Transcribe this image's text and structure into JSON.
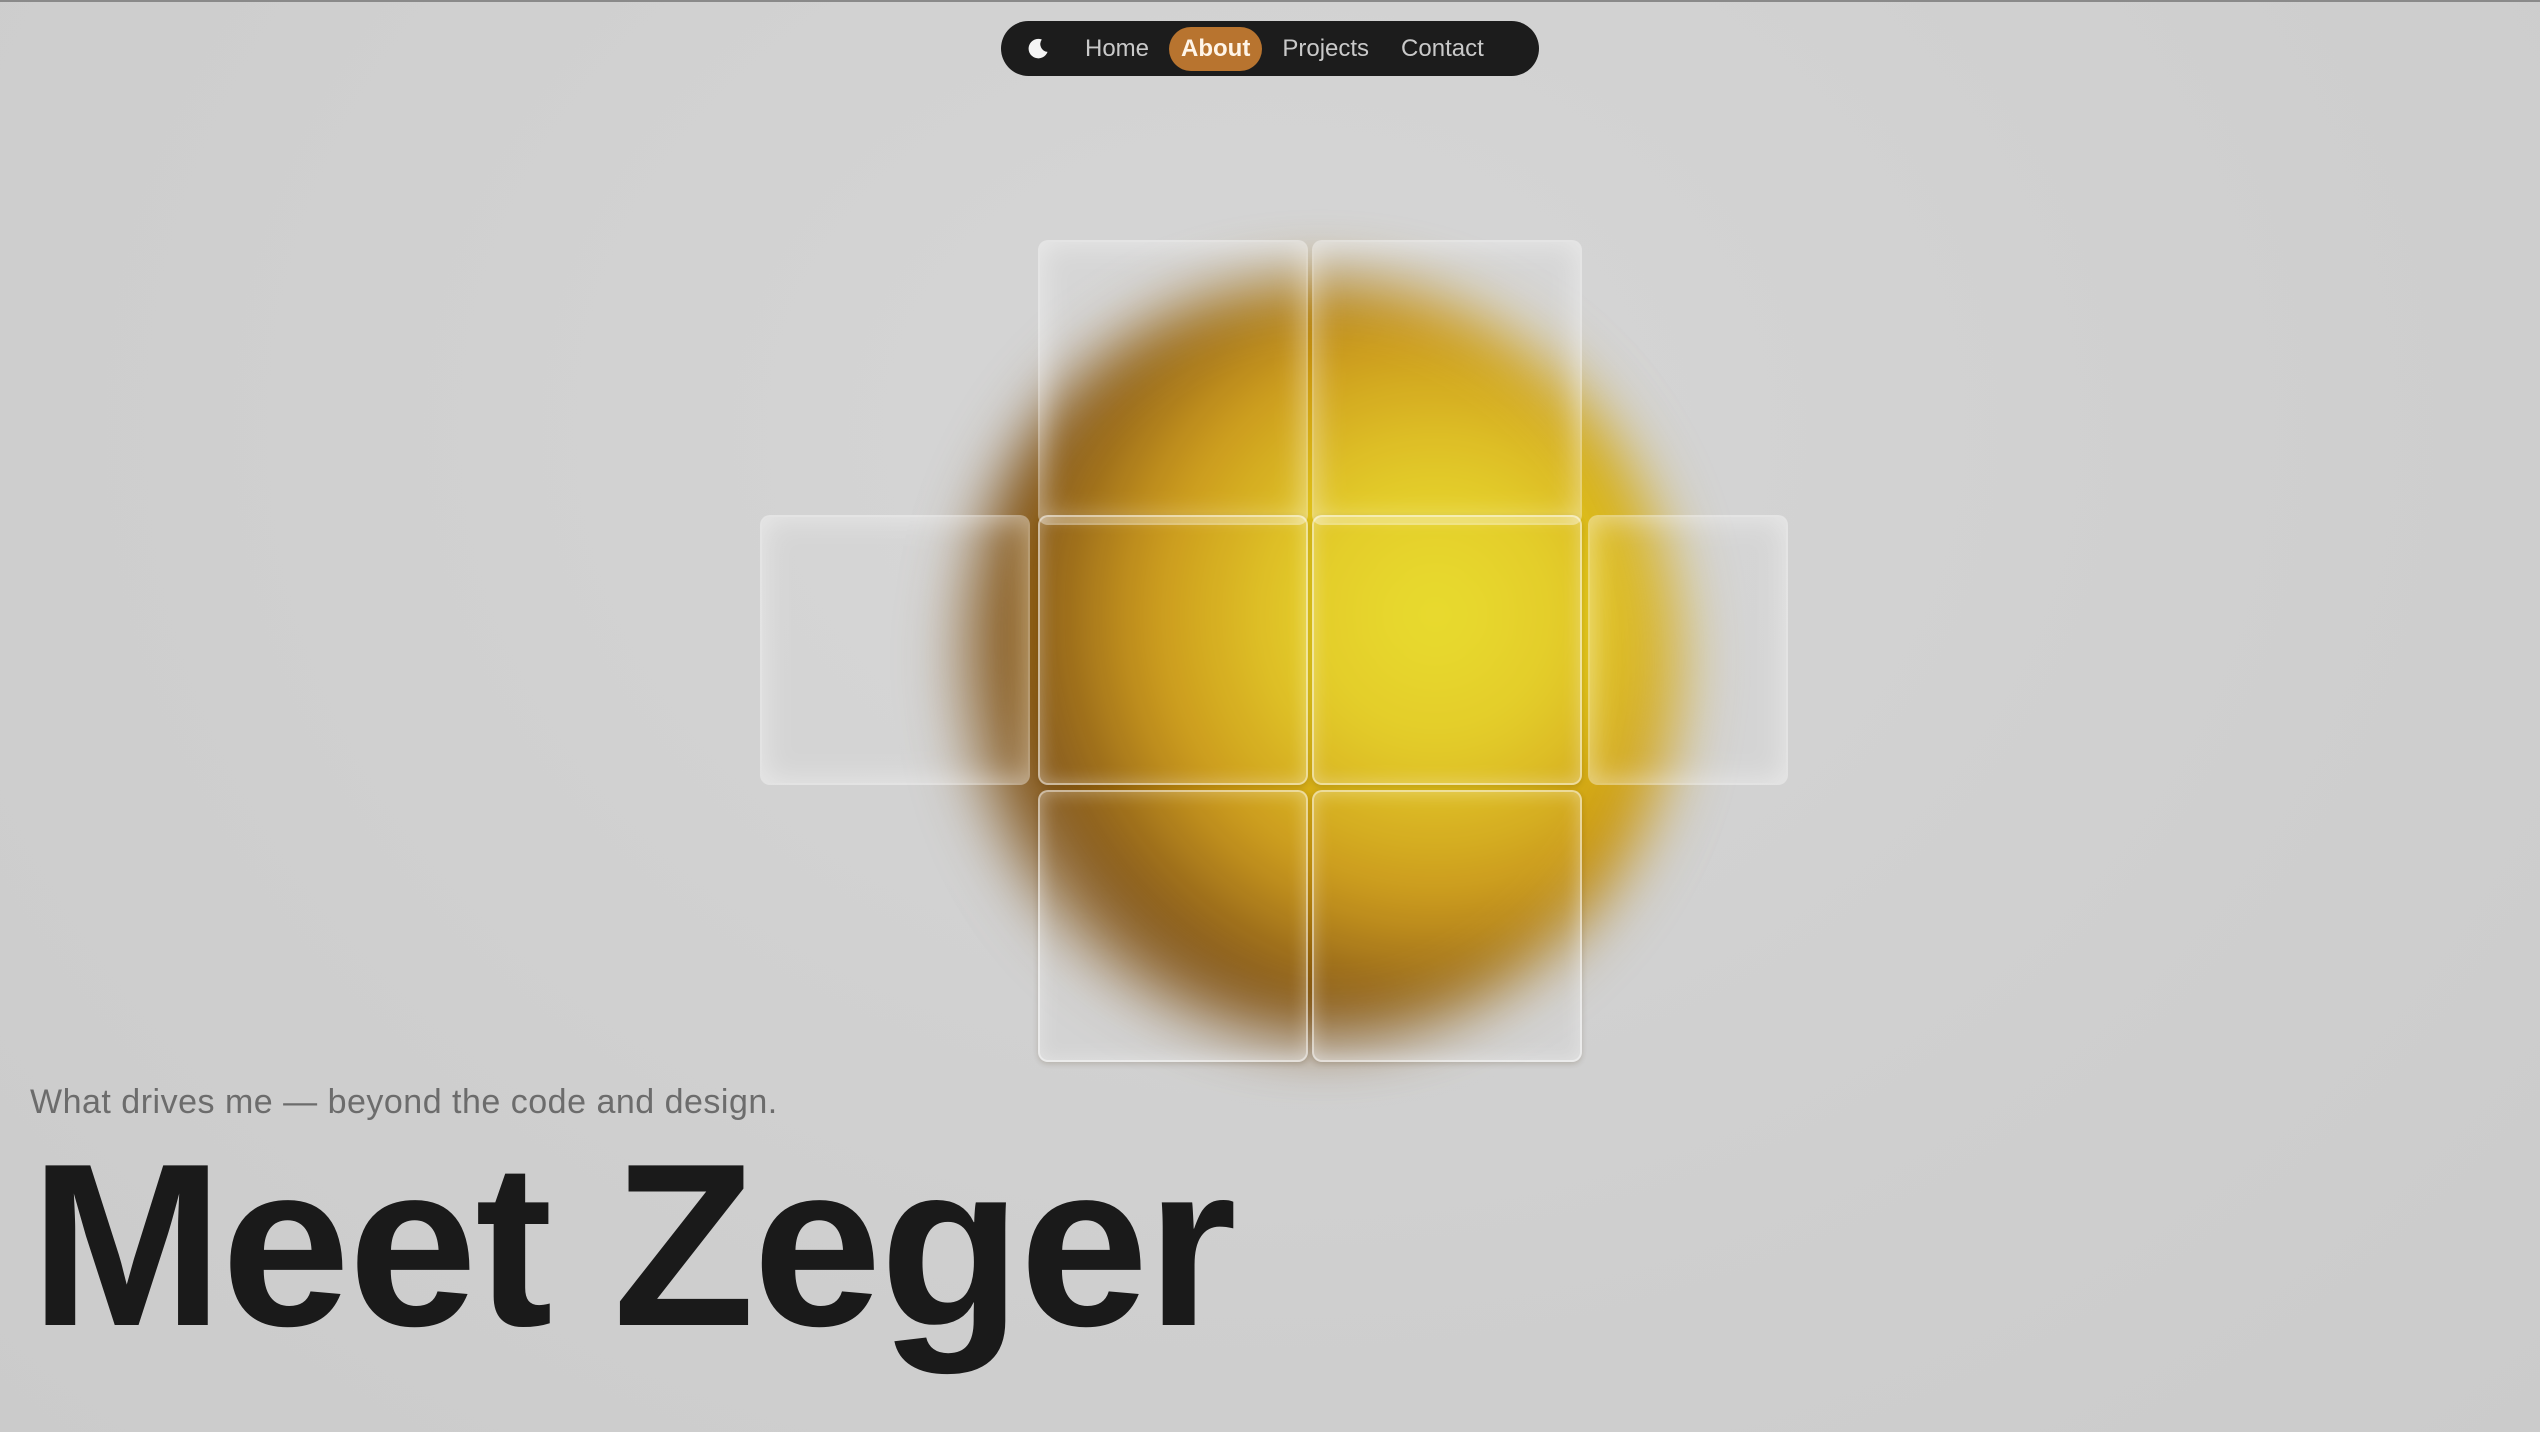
{
  "nav": {
    "theme_toggle_icon": "moon-icon",
    "items": [
      {
        "label": "Home",
        "active": false
      },
      {
        "label": "About",
        "active": true
      },
      {
        "label": "Projects",
        "active": false
      },
      {
        "label": "Contact",
        "active": false
      }
    ],
    "active_color": "#b8742f"
  },
  "hero": {
    "subtitle": "What drives me — beyond the code and design.",
    "title": "Meet Zeger"
  },
  "colors": {
    "background": "#d0d0d0",
    "nav_background": "#1c1c1c",
    "accent_yellow": "#e8dc22",
    "text_dark": "#1a1a1a"
  }
}
